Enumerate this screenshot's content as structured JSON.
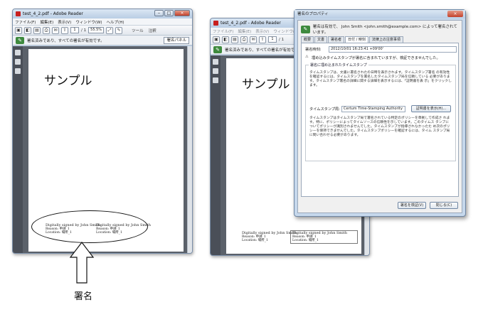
{
  "left_window": {
    "title": "test_4_2.pdf - Adobe Reader",
    "menu": [
      "ファイル(F)",
      "編集(E)",
      "表示(V)",
      "ウィンドウ(W)",
      "ヘルプ(H)"
    ],
    "page_current": "1",
    "page_total": "/ 1",
    "zoom": "55.5%",
    "tools_label": "ツール",
    "comment_label": "注釈",
    "signature_status": "署名済みであり、すべての署名が有効です。",
    "signature_panel_button": "署名パネル",
    "heading": "サンプル",
    "sig_left": [
      "Digitally signed by John Smith",
      "Reason: 申請_1",
      "Location: 場所_1"
    ],
    "sig_right": [
      "Digitally signed by John Smith",
      "Reason: 申請_1",
      "Location: 場所_1"
    ]
  },
  "right_window": {
    "title": "test_4_2.pdf - Adobe Reader",
    "menu": [
      "ファイル(F)",
      "編集(E)",
      "表示(V)",
      "ウィンドウ(W)"
    ],
    "page_current": "1",
    "page_total": "/ 1",
    "signature_status": "署名済みであり、すべての署名が有効です。",
    "heading": "サンプル",
    "sig_left": [
      "Digitally signed by John Smith",
      "Reason: 申請_1",
      "Location: 場所_1"
    ],
    "sig_right": [
      "Digitally signed by John Smith",
      "Reason: 申請_1",
      "Location: 場所_1"
    ]
  },
  "dialog": {
    "title": "署名のプロパティ",
    "status": "署名は有効で、 John Smith <john.smith@example.com> によって署名されています。",
    "tabs": [
      "概要",
      "文書",
      "署名者",
      "日付 / 時刻",
      "法律上の注意事項"
    ],
    "active_tab": "日付 / 時刻",
    "sign_time_label": "署名時刻:",
    "sign_time_value": "2012/10/01 16:23:41 +09'00'",
    "embedded_note": "埋め込みタイムスタンプが署名に含まれていますが、検証できませんでした。",
    "group_title": "署名に埋め込まれたタイムスタンプ",
    "group_para1": "タイムスタンプは、文書に署名されたの日時を表示されます。タイムスタンプ署名 の有効性を確認するには、タイムスタンプを署名したタイムスタンプ局を信頼している 必要があります。タイムスタンプ署名の詳細に関する詳細を表示するには、「証明書を表 示」をクリックします。",
    "tsa_label": "タイムスタンプ局:",
    "tsa_value": "Certum Time-Stamping Authority",
    "show_cert_button": "証明書を表示(H)...",
    "group_para2": "タイムスタンプはタイムスタンプ局で署名されている特定のポリシーを準拠して作成さ れます。特に、ポリシーによってタイムソースの信頼性を示しています。このタイムス タンプについてポリシーが識別されませんでした。タイムスタンプが指導されなかったた め次のポリシーを保持できませんでした。タイムスタンプポリシーを確認するには、タイム スタンプ局に問い合わせる必要があります。",
    "validate_button": "署名を検証(V)",
    "close_button": "閉じる(C)"
  },
  "caption": "署名"
}
